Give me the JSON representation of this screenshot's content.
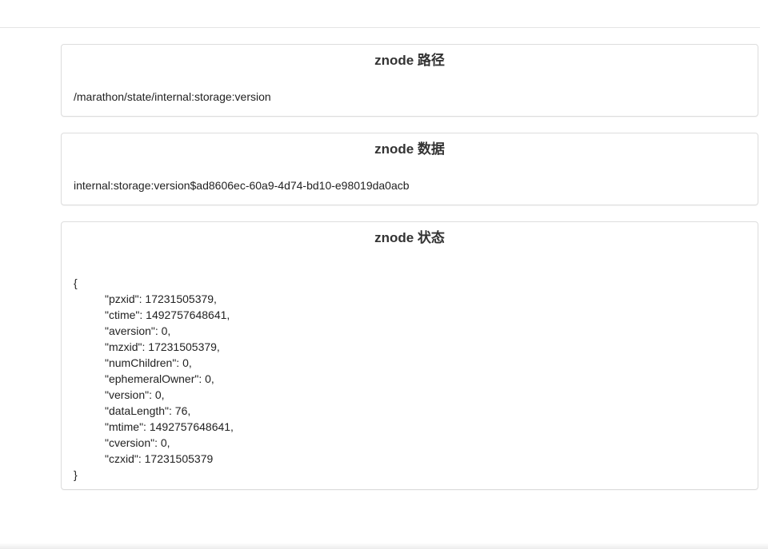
{
  "panels": {
    "path": {
      "title": "znode 路径",
      "value": "/marathon/state/internal:storage:version"
    },
    "data": {
      "title": "znode 数据",
      "value": "internal:storage:version$ad8606ec-60a9-4d74-bd10-e98019da0acb"
    },
    "stat": {
      "title": "znode 状态",
      "open_brace": "{",
      "close_brace": "}",
      "entries": [
        "\"pzxid\": 17231505379,",
        "\"ctime\": 1492757648641,",
        "\"aversion\": 0,",
        "\"mzxid\": 17231505379,",
        "\"numChildren\": 0,",
        "\"ephemeralOwner\": 0,",
        "\"version\": 0,",
        "\"dataLength\": 76,",
        "\"mtime\": 1492757648641,",
        "\"cversion\": 0,",
        "\"czxid\": 17231505379"
      ]
    }
  }
}
